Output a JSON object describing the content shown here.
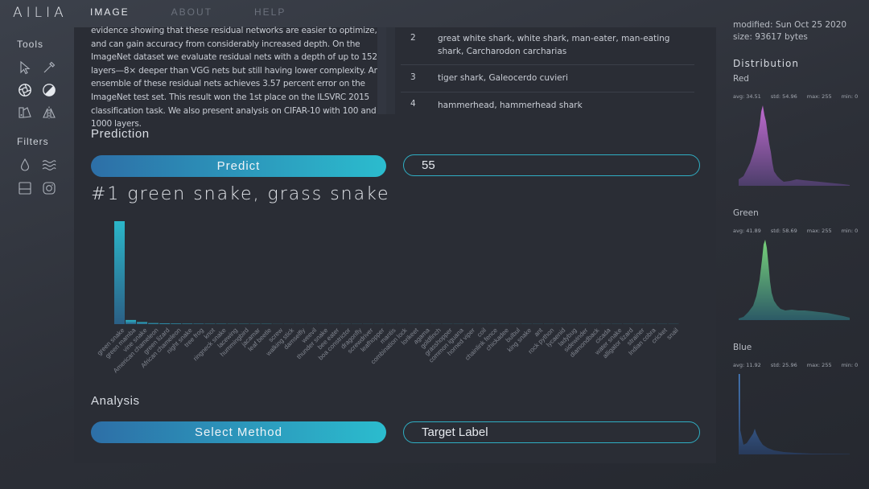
{
  "app": {
    "logo": "AILIA"
  },
  "nav": {
    "items": [
      {
        "label": "IMAGE",
        "active": true
      },
      {
        "label": "ABOUT",
        "active": false
      },
      {
        "label": "HELP",
        "active": false
      }
    ]
  },
  "sidebar": {
    "tools_title": "Tools",
    "tools": [
      "pointer-icon",
      "eyedropper-icon",
      "aperture-icon",
      "contrast-icon",
      "palette-icon",
      "symmetry-icon"
    ],
    "filters_title": "Filters",
    "filters": [
      "droplet-icon",
      "waves-icon",
      "crop-frame-icon",
      "instagram-icon"
    ]
  },
  "abstract": {
    "text": "evidence showing that these residual networks are easier to optimize, and can gain accuracy from considerably increased depth. On the ImageNet dataset we evaluate residual nets with a depth of up to 152 layers—8× deeper than VGG nets but still having lower complexity. An ensemble of these residual nets achieves 3.57 percent error on the ImageNet test set. This result won the 1st place on the ILSVRC 2015 classification task. We also present analysis on CIFAR-10 with 100 and 1000 layers."
  },
  "class_table": {
    "rows": [
      {
        "num": "2",
        "label": "great white shark, white shark, man-eater, man-eating shark, Carcharodon carcharias"
      },
      {
        "num": "3",
        "label": "tiger shark, Galeocerdo cuvieri"
      },
      {
        "num": "4",
        "label": "hammerhead, hammerhead shark"
      }
    ]
  },
  "prediction": {
    "title": "Prediction",
    "predict_label": "Predict",
    "input_value": "55",
    "result": "#1 green snake, grass snake"
  },
  "analysis": {
    "title": "Analysis",
    "method_label": "Select Method",
    "target_label": "Target Label"
  },
  "file_info": {
    "modified": "modified: Sun Oct 25 2020",
    "size": "size: 93617 bytes"
  },
  "distribution": {
    "title": "Distribution",
    "channels": [
      {
        "name": "Red",
        "avg": "avg: 34.51",
        "std": "std: 54.96",
        "max": "max: 255",
        "min": "min: 0",
        "color": "#a05ab0"
      },
      {
        "name": "Green",
        "avg": "avg: 41.89",
        "std": "std: 58.69",
        "max": "max: 255",
        "min": "min: 0",
        "color": "#5fb86a"
      },
      {
        "name": "Blue",
        "avg": "avg: 11.92",
        "std": "std: 25.96",
        "max": "max: 255",
        "min": "min: 0",
        "color": "#3f6fb0"
      }
    ]
  },
  "colors": {
    "accent_start": "#2d6fa7",
    "accent_end": "#2bbcce",
    "bar": "#2a9fb5"
  },
  "chart_data": {
    "type": "bar",
    "categories": [
      "green snake",
      "green mamba",
      "vine snake",
      "American chameleon",
      "green lizard",
      "African chameleon",
      "night snake",
      "tree frog",
      "knot",
      "ringneck snake",
      "lacewing",
      "hummingbird",
      "jacamar",
      "leaf beetle",
      "screw",
      "walking stick",
      "damselfly",
      "weevil",
      "thunder snake",
      "bee eater",
      "boa constrictor",
      "dragonfly",
      "screwdriver",
      "leafhopper",
      "mantis",
      "combination lock",
      "lorikeet",
      "agama",
      "goldfinch",
      "grasshopper",
      "common iguana",
      "horned viper",
      "coil",
      "chainlink fence",
      "chickadee",
      "bulbul",
      "king snake",
      "ant",
      "rock python",
      "lycaenid",
      "ladybug",
      "sidewinder",
      "diamondback",
      "cicada",
      "water snake",
      "alligator lizard",
      "strainer",
      "Indian cobra",
      "cricket",
      "snail"
    ],
    "values": [
      100,
      4.0,
      2.0,
      1.0,
      0.8,
      0.6,
      0.5,
      0.4,
      0.3,
      0.3,
      0.2,
      0.2,
      0.2,
      0.2,
      0.1,
      0.1,
      0.1,
      0.1,
      0.1,
      0.1,
      0.1,
      0.1,
      0.1,
      0.1,
      0.1,
      0.1,
      0.1,
      0.1,
      0.1,
      0.1,
      0.1,
      0.1,
      0.1,
      0.1,
      0.1,
      0.1,
      0.1,
      0.1,
      0.1,
      0.1,
      0.1,
      0.1,
      0.1,
      0.1,
      0.1,
      0.1,
      0.1,
      0.1,
      0.1,
      0.1
    ],
    "ylim": [
      0,
      100
    ],
    "grid": false
  }
}
